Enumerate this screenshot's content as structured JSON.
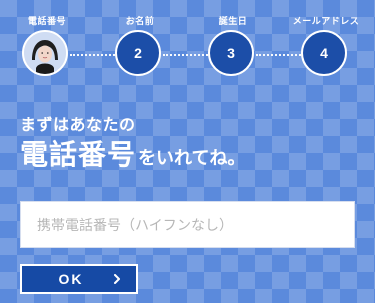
{
  "steps": [
    {
      "label": "電話番号",
      "number": "",
      "state": "current"
    },
    {
      "label": "お名前",
      "number": "2",
      "state": "upcoming"
    },
    {
      "label": "誕生日",
      "number": "3",
      "state": "upcoming"
    },
    {
      "label": "メールアドレス",
      "number": "4",
      "state": "upcoming"
    }
  ],
  "heading": {
    "line1": "まずはあなたの",
    "line2_main": "電話番号",
    "line2_sub": "をいれてね。"
  },
  "phone_input": {
    "value": "",
    "placeholder": "携帯電話番号（ハイフンなし）"
  },
  "ok_button": {
    "label": "OK",
    "icon": "chevron-right-icon"
  },
  "colors": {
    "background_light": "#7fa6e6",
    "background_dark": "#5f8fe0",
    "step_circle": "#1c4ea8",
    "button": "#164aa5",
    "white": "#ffffff"
  }
}
